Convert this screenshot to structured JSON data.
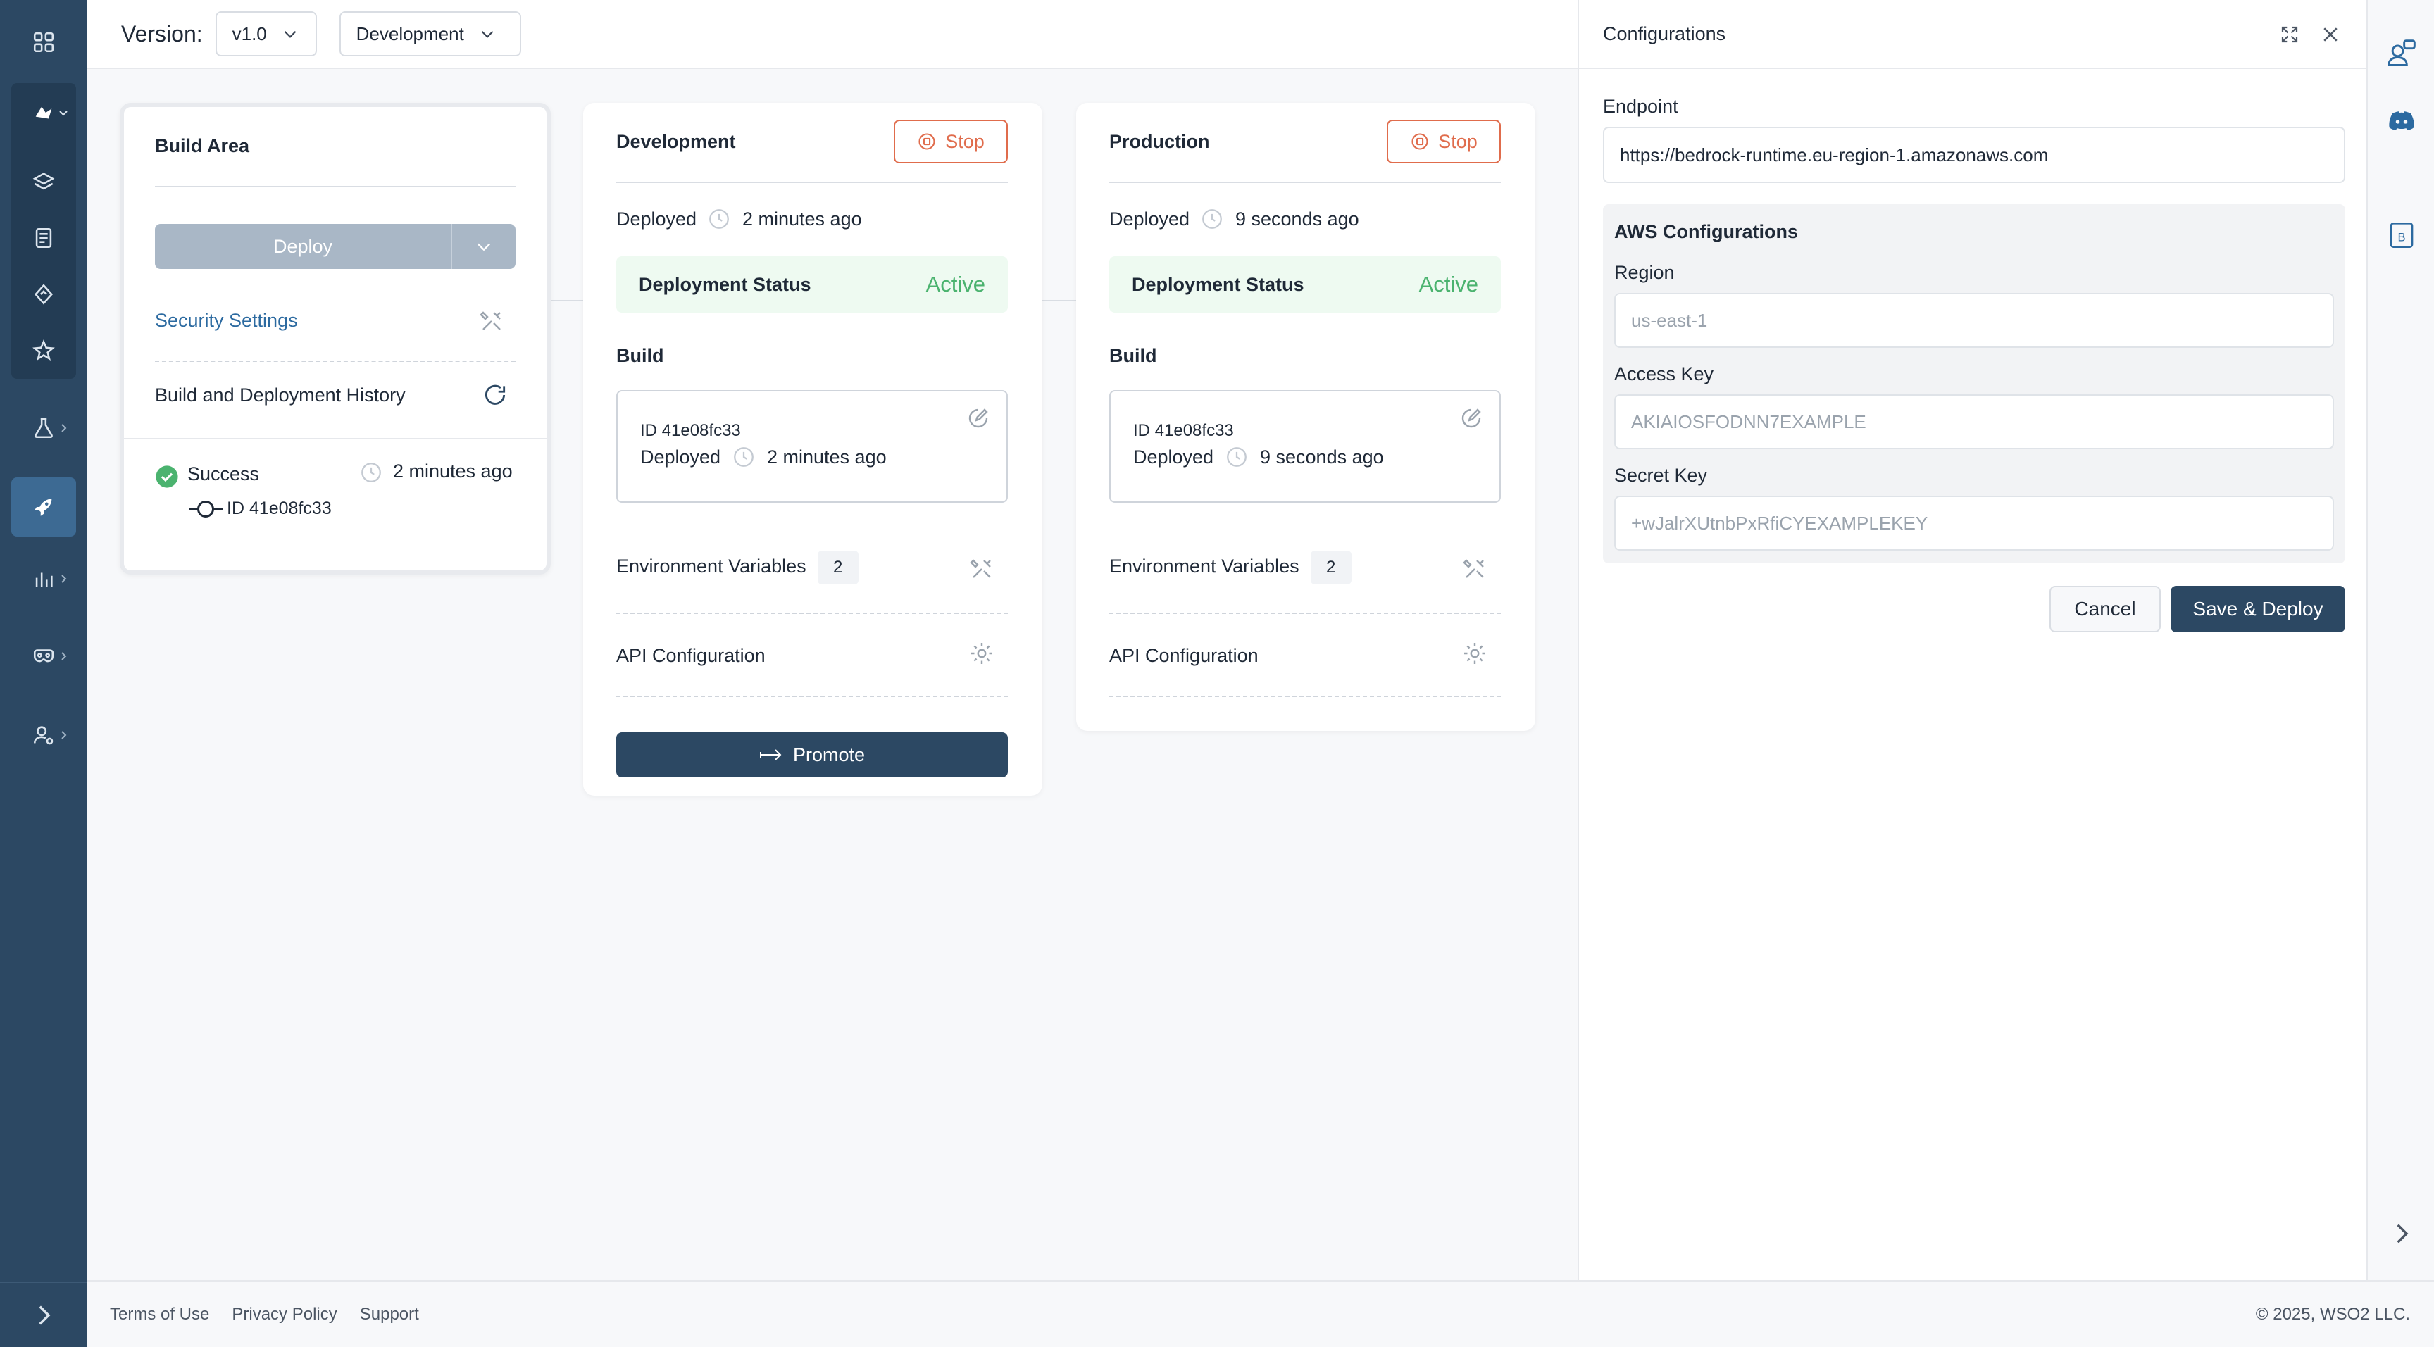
{
  "header": {
    "version_label": "Version:",
    "version_value": "v1.0",
    "environment_value": "Development"
  },
  "build_area": {
    "title": "Build Area",
    "deploy_label": "Deploy",
    "security_settings": "Security Settings",
    "history_title": "Build and Deployment History",
    "history_status": "Success",
    "history_time": "2 minutes ago",
    "history_id": "ID 41e08fc33"
  },
  "environments": [
    {
      "title": "Development",
      "stop_label": "Stop",
      "deployed_label": "Deployed",
      "deployed_time": "2 minutes ago",
      "status_key": "Deployment Status",
      "status_value": "Active",
      "build_title": "Build",
      "build_id": "ID 41e08fc33",
      "build_deployed_label": "Deployed",
      "build_deployed_time": "2 minutes ago",
      "env_vars_label": "Environment Variables",
      "env_vars_count": "2",
      "api_config_label": "API Configuration",
      "promote_label": "Promote"
    },
    {
      "title": "Production",
      "stop_label": "Stop",
      "deployed_label": "Deployed",
      "deployed_time": "9 seconds ago",
      "status_key": "Deployment Status",
      "status_value": "Active",
      "build_title": "Build",
      "build_id": "ID 41e08fc33",
      "build_deployed_label": "Deployed",
      "build_deployed_time": "9 seconds ago",
      "env_vars_label": "Environment Variables",
      "env_vars_count": "2",
      "api_config_label": "API Configuration"
    }
  ],
  "config_panel": {
    "title": "Configurations",
    "endpoint_label": "Endpoint",
    "endpoint_value": "https://bedrock-runtime.eu-region-1.amazonaws.com",
    "aws_title": "AWS Configurations",
    "region_label": "Region",
    "region_placeholder": "us-east-1",
    "access_key_label": "Access Key",
    "access_key_placeholder": "AKIAIOSFODNN7EXAMPLE",
    "secret_key_label": "Secret Key",
    "secret_key_placeholder": "+wJalrXUtnbPxRfiCYEXAMPLEKEY",
    "cancel_label": "Cancel",
    "save_label": "Save & Deploy"
  },
  "footer": {
    "terms": "Terms of Use",
    "privacy": "Privacy Policy",
    "support": "Support",
    "copyright": "© 2025, WSO2 LLC."
  },
  "colors": {
    "sidebar": "#2c4863",
    "primary_button": "#2c4863",
    "stop": "#e06c4c",
    "active": "#4bb36f",
    "link": "#2c6aa0"
  },
  "icons": {
    "sidebar": [
      "grid-icon",
      "project-icon",
      "layers-icon",
      "document-icon",
      "sync-icon",
      "star-icon",
      "flask-icon",
      "rocket-icon",
      "chart-icon",
      "mask-icon",
      "user-settings-icon"
    ],
    "rail": [
      "support-agent-icon",
      "discord-icon",
      "b-book-icon"
    ]
  }
}
